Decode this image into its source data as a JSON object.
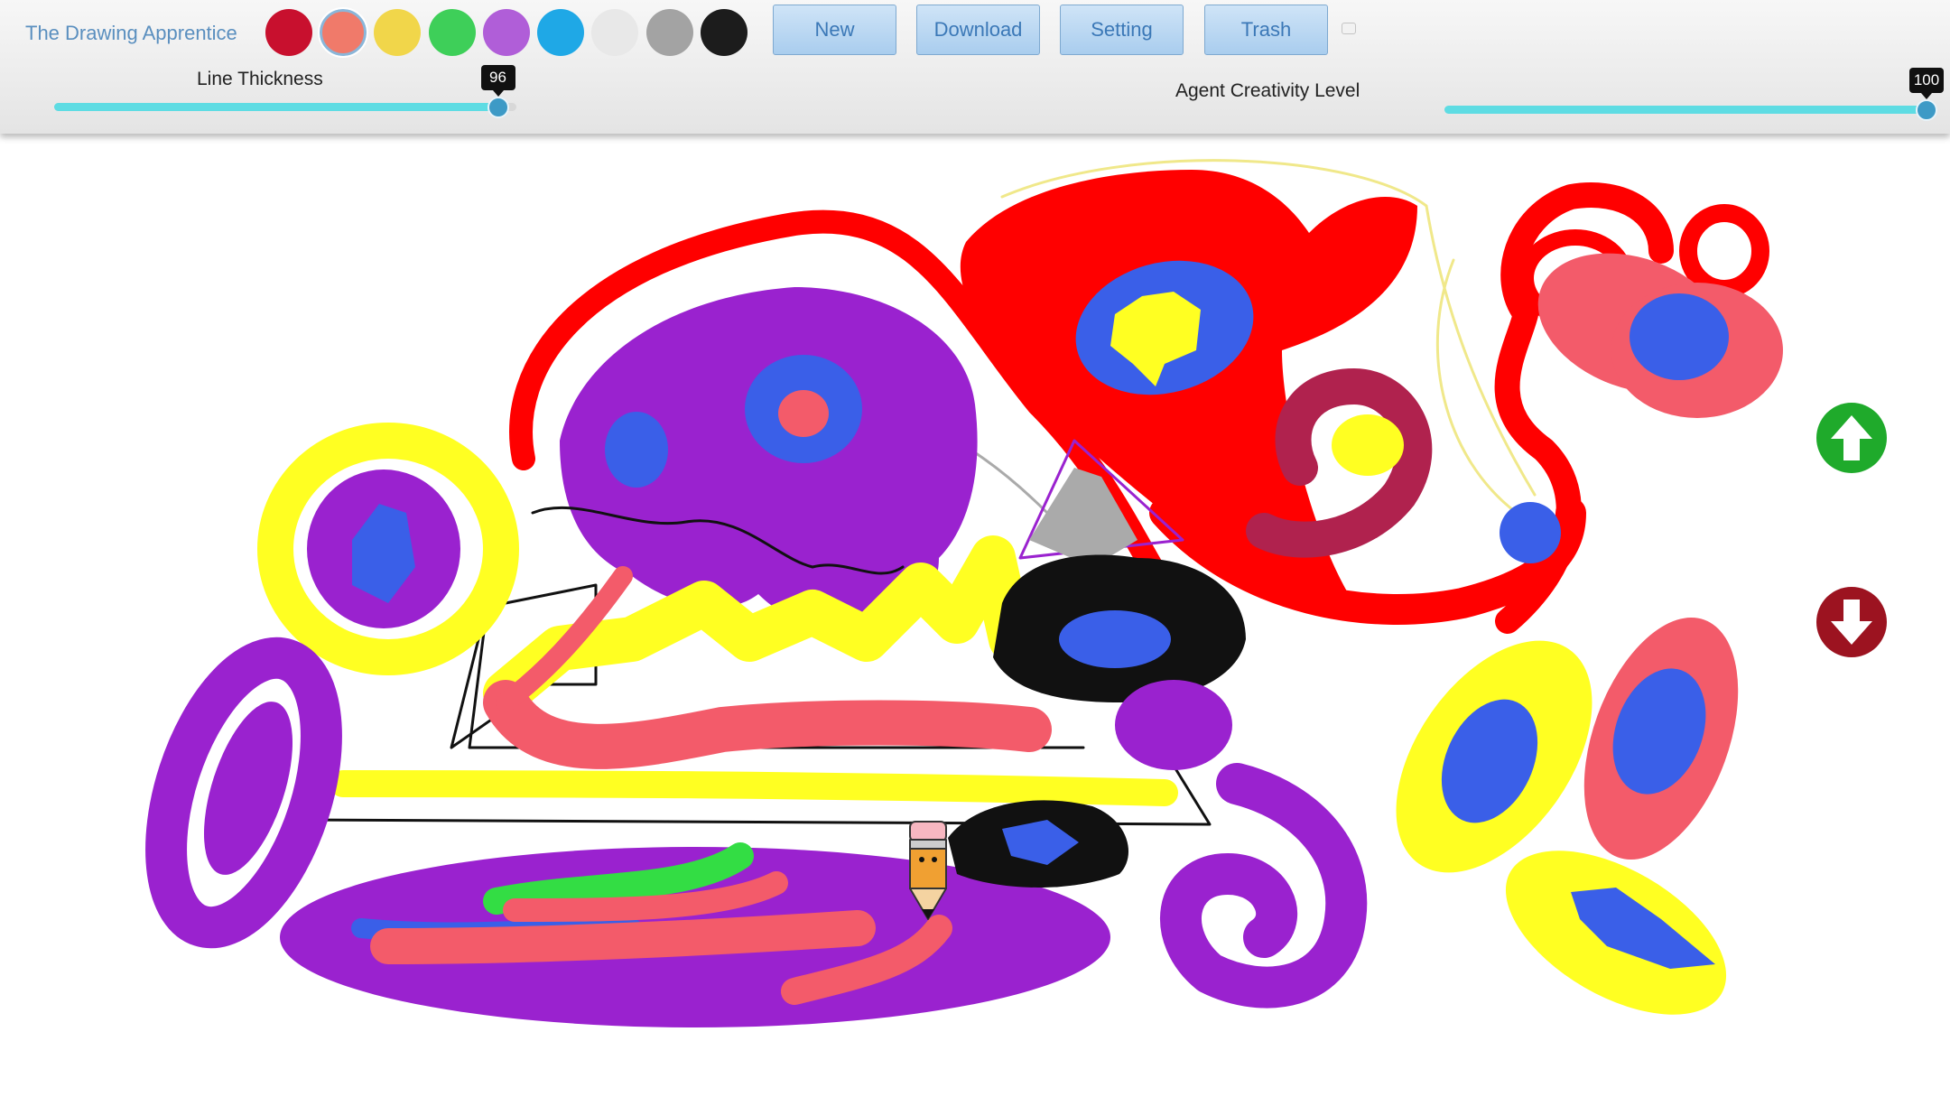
{
  "app": {
    "title": "The Drawing Apprentice"
  },
  "palette": {
    "selected": "#f07a6a",
    "colors": [
      "#c8102e",
      "#f07a6a",
      "#f1d64a",
      "#3ecf59",
      "#b05ed8",
      "#1fa8e6",
      "#e8e8e8",
      "#a3a3a3",
      "#1c1c1c"
    ]
  },
  "toolbar": {
    "buttons": [
      {
        "label": "New"
      },
      {
        "label": "Download"
      },
      {
        "label": "Setting"
      },
      {
        "label": "Trash"
      }
    ]
  },
  "line_thickness": {
    "label": "Line Thickness",
    "value": "96",
    "level": 96
  },
  "creativity": {
    "label": "Agent Creativity Level",
    "value": "100",
    "level": 100
  },
  "navigation": {
    "up_icon": "arrow-up-icon",
    "up_color": "#1faa2b",
    "down_icon": "arrow-down-icon",
    "down_color": "#9c1320"
  },
  "cursor": {
    "icon": "pencil-icon"
  }
}
